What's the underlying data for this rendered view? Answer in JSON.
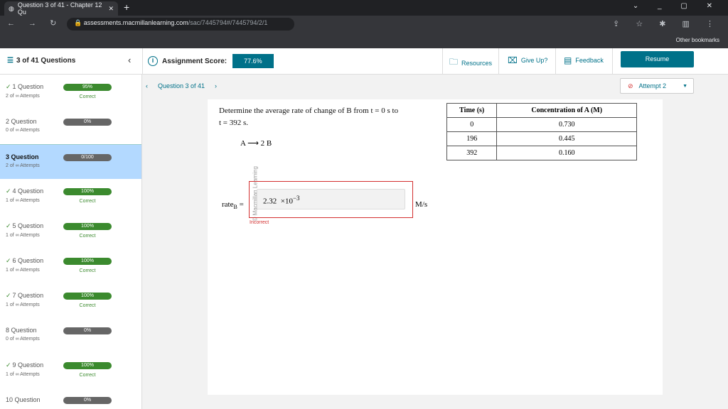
{
  "browser": {
    "tab_title": "Question 3 of 41 - Chapter 12 Qu",
    "url_host": "assessments.macmillanlearning.com",
    "url_path": "/sac/7445794#/7445794/2/1",
    "bookmarks": "Other bookmarks"
  },
  "header": {
    "question_count": "3 of 41 Questions",
    "score_label": "Assignment Score:",
    "score": "77.6%",
    "resources": "Resources",
    "give_up": "Give Up?",
    "feedback": "Feedback",
    "resume": "Resume"
  },
  "sidebar": {
    "items": [
      {
        "title": "1 Question",
        "attempts": "2 of ∞ Attempts",
        "score": "95%",
        "status": "Correct",
        "done": true
      },
      {
        "title": "2 Question",
        "attempts": "0 of ∞ Attempts",
        "score": "0%",
        "status": "",
        "done": false
      },
      {
        "title": "3 Question",
        "attempts": "2 of ∞ Attempts",
        "score": "0/100",
        "status": "",
        "done": false,
        "active": true
      },
      {
        "title": "4 Question",
        "attempts": "1 of ∞ Attempts",
        "score": "100%",
        "status": "Correct",
        "done": true
      },
      {
        "title": "5 Question",
        "attempts": "1 of ∞ Attempts",
        "score": "100%",
        "status": "Correct",
        "done": true
      },
      {
        "title": "6 Question",
        "attempts": "1 of ∞ Attempts",
        "score": "100%",
        "status": "Correct",
        "done": true
      },
      {
        "title": "7 Question",
        "attempts": "1 of ∞ Attempts",
        "score": "100%",
        "status": "Correct",
        "done": true
      },
      {
        "title": "8 Question",
        "attempts": "0 of ∞ Attempts",
        "score": "0%",
        "status": "",
        "done": false
      },
      {
        "title": "9 Question",
        "attempts": "1 of ∞ Attempts",
        "score": "100%",
        "status": "Correct",
        "done": true
      },
      {
        "title": "10 Question",
        "attempts": "",
        "score": "0%",
        "status": "",
        "done": false
      }
    ]
  },
  "question": {
    "nav_label": "Question 3 of 41",
    "attempt": "Attempt 2",
    "watermark": "© Macmillan Learning",
    "prompt_line1": "Determine the average rate of change of B from t = 0 s to",
    "prompt_line2": "t = 392 s.",
    "reaction": "A ⟶ 2 B",
    "table": {
      "headers": [
        "Time (s)",
        "Concentration of A (M)"
      ],
      "rows": [
        [
          "0",
          "0.730"
        ],
        [
          "196",
          "0.445"
        ],
        [
          "392",
          "0.160"
        ]
      ]
    },
    "rate_label": "rate",
    "rate_sub": "B",
    "equals": "=",
    "answer_mantissa": "2.32",
    "answer_times": "×10",
    "answer_exp": "−3",
    "unit": "M/s",
    "feedback": "Incorrect"
  }
}
